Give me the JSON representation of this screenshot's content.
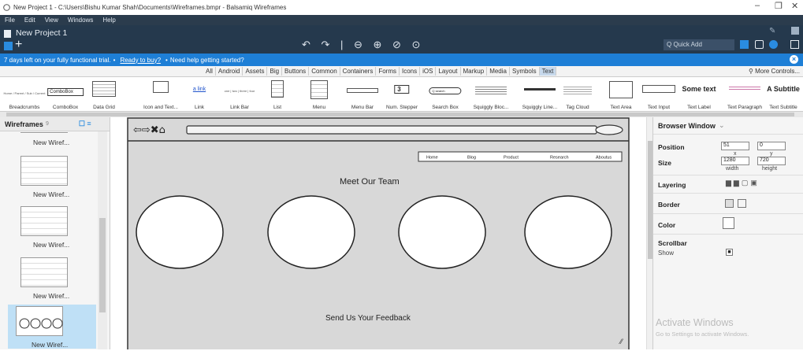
{
  "window": {
    "title": "New Project 1 - C:\\Users\\Bishu Kumar Shah\\Documents\\Wireframes.bmpr - Balsamiq Wireframes",
    "min": "–",
    "max": "❐",
    "close": "✕"
  },
  "menu": [
    "File",
    "Edit",
    "View",
    "Windows",
    "Help"
  ],
  "project": {
    "name": "New Project 1",
    "quick_add": "Q Quick Add"
  },
  "trial": {
    "text": "7 days left on your fully functional trial.",
    "sep1": "•",
    "link": "Ready to buy?",
    "sep2": "•",
    "help": "Need help getting started?"
  },
  "categories": [
    "All",
    "Android",
    "Assets",
    "Big",
    "Buttons",
    "Common",
    "Containers",
    "Forms",
    "Icons",
    "iOS",
    "Layout",
    "Markup",
    "Media",
    "Symbols",
    "Text"
  ],
  "selected_category": "Text",
  "more_controls": "More Controls...",
  "library": [
    {
      "label": "Breadcrumbs",
      "preview": "Home / Parent / Sub / Current"
    },
    {
      "label": "ComboBox",
      "preview": "ComboBox"
    },
    {
      "label": "Data Grid",
      "preview": ""
    },
    {
      "label": "Icon and Text...",
      "preview": "Icon Name"
    },
    {
      "label": "Link",
      "preview": "a link"
    },
    {
      "label": "Link Bar",
      "preview": "one | two | three | four"
    },
    {
      "label": "List",
      "preview": ""
    },
    {
      "label": "Menu",
      "preview": ""
    },
    {
      "label": "Menu Bar",
      "preview": ""
    },
    {
      "label": "Num. Stepper",
      "preview": "3"
    },
    {
      "label": "Search Box",
      "preview": "Q search"
    },
    {
      "label": "Squiggly Bloc...",
      "preview": ""
    },
    {
      "label": "Squiggly Line...",
      "preview": ""
    },
    {
      "label": "Tag Cloud",
      "preview": ""
    },
    {
      "label": "Text Area",
      "preview": ""
    },
    {
      "label": "Text Input",
      "preview": ""
    },
    {
      "label": "Text Label",
      "preview": "Some text"
    },
    {
      "label": "Text Paragraph",
      "preview": ""
    },
    {
      "label": "Text Subtitle",
      "preview": "A Subtitle"
    }
  ],
  "wireframes_panel": {
    "title": "Wireframes",
    "count": "9",
    "items": [
      "New Wiref...",
      "New Wiref...",
      "New Wiref...",
      "New Wiref...",
      "New Wiref..."
    ]
  },
  "mockup": {
    "nav": [
      "Home",
      "Blog",
      "Product",
      "Research",
      "Aboutus"
    ],
    "heading": "Meet Our Team",
    "feedback": "Send Us Your Feedback"
  },
  "inspector": {
    "title": "Browser Window",
    "position_label": "Position",
    "x": "51",
    "y": "0",
    "x_label": "x",
    "y_label": "y",
    "size_label": "Size",
    "width": "1280",
    "height": "720",
    "width_label": "width",
    "height_label": "height",
    "layering": "Layering",
    "border": "Border",
    "color": "Color",
    "scrollbar": "Scrollbar",
    "show": "Show"
  },
  "watermark": {
    "title": "Activate Windows",
    "sub": "Go to Settings to activate Windows."
  },
  "colors": {
    "menubar": "#2b3c4d",
    "toolbar": "#25394d",
    "trial": "#1e7fd6",
    "canvas": "#d8d8d8"
  }
}
